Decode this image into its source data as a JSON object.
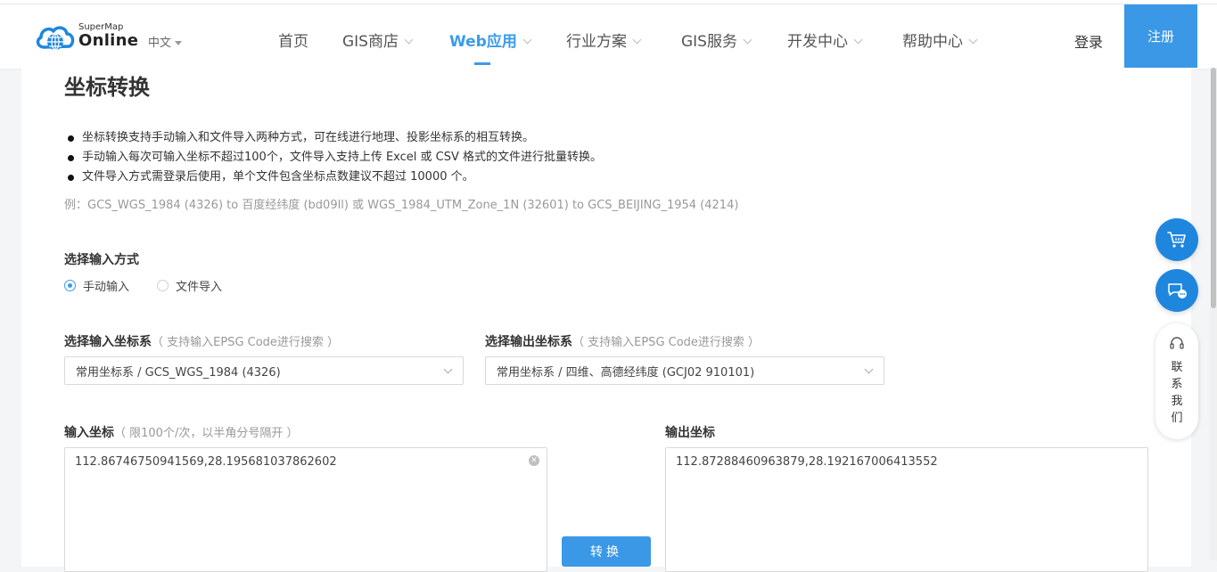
{
  "header": {
    "logo_small": "SuperMap",
    "logo_big": "Online",
    "language": "中文",
    "nav": [
      {
        "label": "首页",
        "has_dropdown": false,
        "active": false
      },
      {
        "label": "GIS商店",
        "has_dropdown": true,
        "active": false
      },
      {
        "label": "Web应用",
        "has_dropdown": true,
        "active": true
      },
      {
        "label": "行业方案",
        "has_dropdown": true,
        "active": false
      },
      {
        "label": "GIS服务",
        "has_dropdown": true,
        "active": false
      },
      {
        "label": "开发中心",
        "has_dropdown": true,
        "active": false
      },
      {
        "label": "帮助中心",
        "has_dropdown": true,
        "active": false
      }
    ],
    "login": "登录",
    "register": "注册"
  },
  "page": {
    "title": "坐标转换",
    "bullets": [
      "坐标转换支持手动输入和文件导入两种方式，可在线进行地理、投影坐标系的相互转换。",
      "手动输入每次可输入坐标不超过100个，文件导入支持上传 Excel 或 CSV 格式的文件进行批量转换。",
      "文件导入方式需登录后使用，单个文件包含坐标点数建议不超过 10000 个。"
    ],
    "example": "例：GCS_WGS_1984 (4326) to 百度经纬度 (bd09ll) 或 WGS_1984_UTM_Zone_1N (32601) to GCS_BEIJING_1954 (4214)",
    "input_method_label": "选择输入方式",
    "input_methods": [
      {
        "label": "手动输入",
        "checked": true
      },
      {
        "label": "文件导入",
        "checked": false
      }
    ],
    "input_crs_label": "选择输入坐标系",
    "input_crs_hint": "（ 支持输入EPSG Code进行搜索 ）",
    "input_crs_value": "常用坐标系 / GCS_WGS_1984 (4326)",
    "output_crs_label": "选择输出坐标系",
    "output_crs_hint": "（ 支持输入EPSG Code进行搜索 ）",
    "output_crs_value": "常用坐标系 / 四维、高德经纬度 (GCJ02 910101)",
    "input_coords_label": "输入坐标",
    "input_coords_hint": "（ 限100个/次，以半角分号隔开 ）",
    "input_coords_value": "112.86746750941569,28.195681037862602",
    "output_coords_label": "输出坐标",
    "output_coords_value": "112.87288460963879,28.192167006413552",
    "convert_button": "转换"
  },
  "floating": {
    "contact_text": "联系我们"
  },
  "colors": {
    "accent": "#3a98e6",
    "float_button": "#1f86dd"
  }
}
